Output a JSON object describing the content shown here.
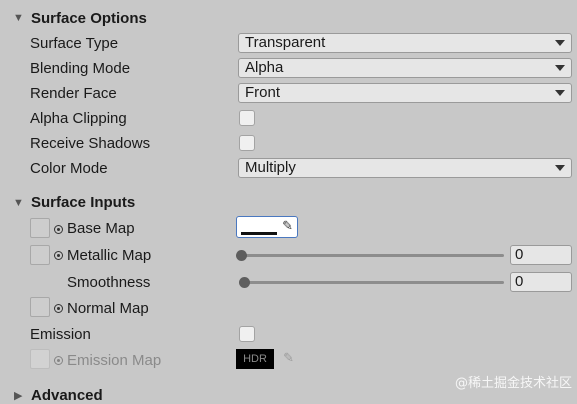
{
  "surface_options": {
    "header": "Surface Options",
    "surface_type": {
      "label": "Surface Type",
      "value": "Transparent"
    },
    "blending_mode": {
      "label": "Blending Mode",
      "value": "Alpha"
    },
    "render_face": {
      "label": "Render Face",
      "value": "Front"
    },
    "alpha_clipping": {
      "label": "Alpha Clipping",
      "checked": false
    },
    "receive_shadows": {
      "label": "Receive Shadows",
      "checked": false
    },
    "color_mode": {
      "label": "Color Mode",
      "value": "Multiply"
    }
  },
  "surface_inputs": {
    "header": "Surface Inputs",
    "base_map": {
      "label": "Base Map",
      "color": "#ffffff"
    },
    "metallic_map": {
      "label": "Metallic Map",
      "value": "0",
      "slider": 0
    },
    "smoothness": {
      "label": "Smoothness",
      "value": "0",
      "slider": 0
    },
    "normal_map": {
      "label": "Normal Map"
    },
    "emission": {
      "label": "Emission",
      "checked": false
    },
    "emission_map": {
      "label": "Emission Map",
      "color_label": "HDR",
      "color": "#000000"
    }
  },
  "advanced": {
    "header": "Advanced"
  },
  "watermark": "@稀土掘金技术社区",
  "colors": {
    "panel": "#c8c8c8",
    "field": "#e6e6e6",
    "accent": "#4a78c0"
  }
}
